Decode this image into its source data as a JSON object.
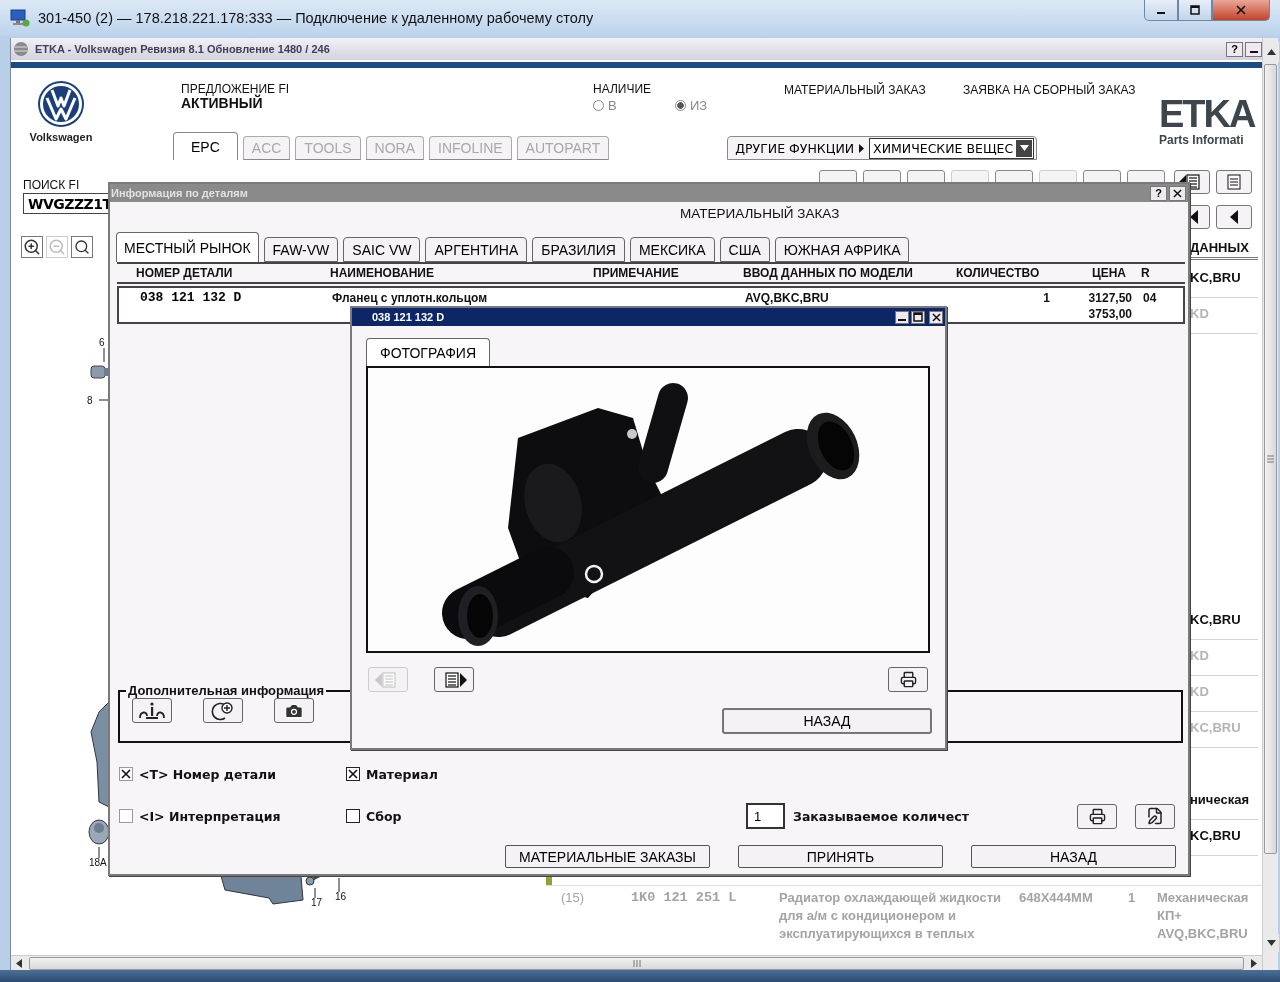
{
  "rdp_window": {
    "title": "301-450 (2) — 178.218.221.178:333 — Подключение к удаленному рабочему столу"
  },
  "app_window": {
    "title": "ETKA - Volkswagen Ревизия 8.1 Обновление 1480 / 246",
    "help_button": "?"
  },
  "brand": {
    "name": "Volkswagen",
    "product_logo": "ETKA",
    "product_tagline": "Parts Informati"
  },
  "offer": {
    "label": "ПРЕДЛОЖЕНИЕ FI",
    "value": "АКТИВНЫЙ"
  },
  "availability": {
    "label": "НАЛИЧИЕ",
    "options": [
      {
        "label": "В",
        "selected": false
      },
      {
        "label": "ИЗ",
        "selected": true
      }
    ]
  },
  "header_links": [
    "МАТЕРИАЛЬНЫЙ ЗАКАЗ",
    "ЗАЯВКА НА СБОРНЫЙ ЗАКАЗ"
  ],
  "module_tabs": [
    {
      "label": "EPC",
      "selected": true,
      "disabled": false
    },
    {
      "label": "ACC",
      "selected": false,
      "disabled": true
    },
    {
      "label": "TOOLS",
      "selected": false,
      "disabled": true
    },
    {
      "label": "NORA",
      "selected": false,
      "disabled": true
    },
    {
      "label": "INFOLINE",
      "selected": false,
      "disabled": true
    },
    {
      "label": "AUTOPART",
      "selected": false,
      "disabled": true
    }
  ],
  "other_functions": {
    "label": "ДРУГИЕ ФУНКЦИИ",
    "dropdown_value": "ХИМИЧЕСКИЕ ВЕЩЕС"
  },
  "search": {
    "label": "ПОИСК FI",
    "value": "WVGZZZ1T"
  },
  "zoom_tools": [
    {
      "kind": "zoom-in",
      "disabled": false
    },
    {
      "kind": "zoom-out",
      "disabled": true
    },
    {
      "kind": "zoom-area",
      "disabled": false
    }
  ],
  "diagram_labels": [
    "6",
    "8",
    "18A",
    "17",
    "16"
  ],
  "parts_list": {
    "column_header": "ДАННЫХ",
    "cells": [
      {
        "text": "KC,BRU",
        "dimmed": false
      },
      {
        "text": "KD",
        "dimmed": true
      },
      {
        "text": "KC,BRU",
        "dimmed": false
      },
      {
        "text": "KD",
        "dimmed": true
      },
      {
        "text": "KD",
        "dimmed": true
      },
      {
        "text": "KC,BRU",
        "dimmed": true
      },
      {
        "text": "ническая",
        "dimmed": false
      },
      {
        "text": "KC,BRU",
        "dimmed": false
      }
    ],
    "row": {
      "position": "(15)",
      "part_number": "1K0 121 251 L",
      "name": "Радиатор охлаждающей жидкости для а/м с кондиционером и эксплуатирующихся в теплых",
      "note": "648X444MM",
      "quantity": "1",
      "model": "Механическая КП+ AVQ,BKC,BRU"
    }
  },
  "part_info_dialog": {
    "title": "Информация по деталям",
    "help_button": "?",
    "heading": "МАТЕРИАЛЬНЫЙ ЗАКАЗ",
    "market_tabs": [
      {
        "label": "МЕСТНЫЙ РЫНОК",
        "selected": true
      },
      {
        "label": "FAW-VW",
        "selected": false
      },
      {
        "label": "SAIC VW",
        "selected": false
      },
      {
        "label": "АРГЕНТИНА",
        "selected": false
      },
      {
        "label": "БРАЗИЛИЯ",
        "selected": false
      },
      {
        "label": "МЕКСИКА",
        "selected": false
      },
      {
        "label": "США",
        "selected": false
      },
      {
        "label": "ЮЖНАЯ АФРИКА",
        "selected": false
      }
    ],
    "columns": [
      "НОМЕР ДЕТАЛИ",
      "НАИМЕНОВАНИЕ",
      "ПРИМЕЧАНИЕ",
      "ВВОД ДАННЫХ ПО МОДЕЛИ",
      "КОЛИЧЕСТВО",
      "ЦЕНА",
      "R"
    ],
    "rows": [
      {
        "part_number": "038 121 132 D",
        "name": "Фланец с уплотн.кольцом",
        "model": "AVQ,BKC,BRU",
        "quantity": "1",
        "price": "3127,50",
        "price_2": "3753,00",
        "r": "04"
      }
    ],
    "extra_info_title": "Дополнительная информация",
    "options": [
      {
        "label": "<T> Номер детали",
        "checked": true,
        "disabled": true
      },
      {
        "label": "Материал",
        "checked": true,
        "disabled": false
      },
      {
        "label": "<I> Интерпретация",
        "checked": false,
        "disabled": true
      },
      {
        "label": "Сбор",
        "checked": false,
        "disabled": false
      }
    ],
    "order_quantity": {
      "value": "1",
      "label": "Заказываемое количест"
    },
    "buttons": [
      "МАТЕРИАЛЬНЫЕ ЗАКАЗЫ",
      "ПРИНЯТЬ",
      "НАЗАД"
    ]
  },
  "photo_dialog": {
    "title": "038 121 132 D",
    "tabs": [
      {
        "label": "ФОТОГРАФИЯ",
        "selected": true
      }
    ],
    "prev_disabled": true,
    "back_button": "НАЗАД"
  }
}
